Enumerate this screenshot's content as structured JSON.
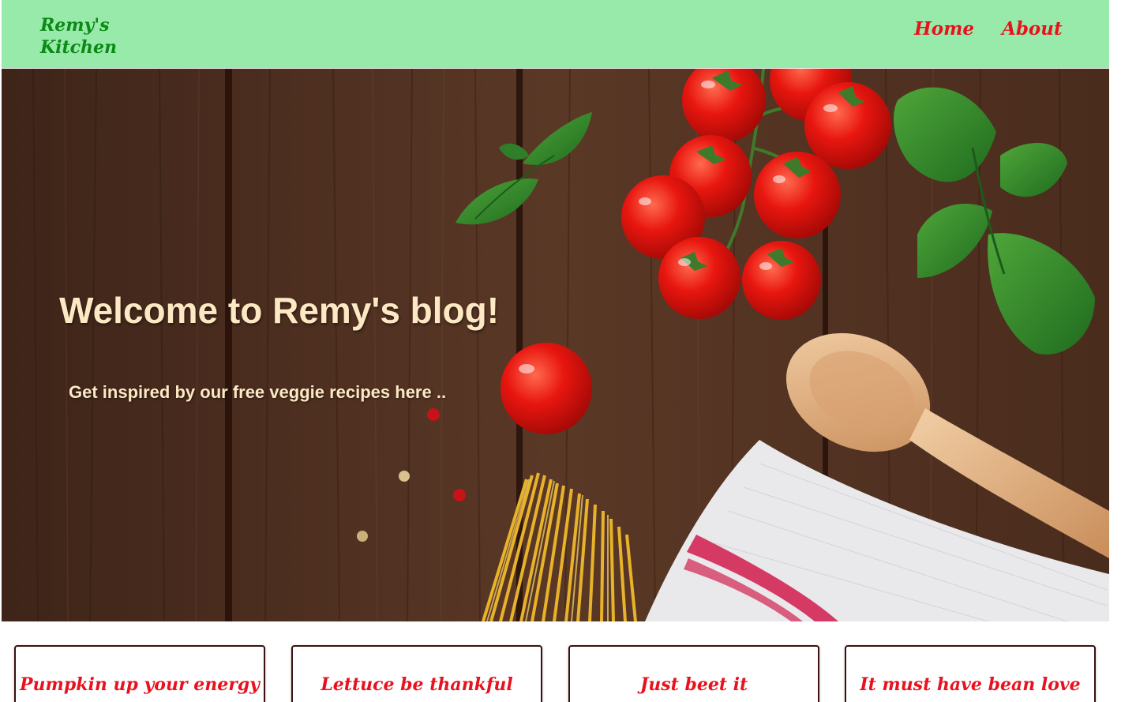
{
  "navbar": {
    "brand": "Remy's Kitchen",
    "links": [
      {
        "label": "Home"
      },
      {
        "label": "About"
      }
    ],
    "background_color": "#98eaaa",
    "brand_color": "#0b8a16",
    "link_color": "#e8121e"
  },
  "hero": {
    "title": "Welcome to Remy's blog!",
    "subtitle": "Get inspired by our free veggie recipes here ..",
    "text_color": "#fde8c4"
  },
  "cards": [
    {
      "title": "Pumpkin up your energy"
    },
    {
      "title": "Lettuce be thankful"
    },
    {
      "title": "Just beet it"
    },
    {
      "title": "It must have bean love"
    }
  ],
  "card_title_color": "#e8121e"
}
